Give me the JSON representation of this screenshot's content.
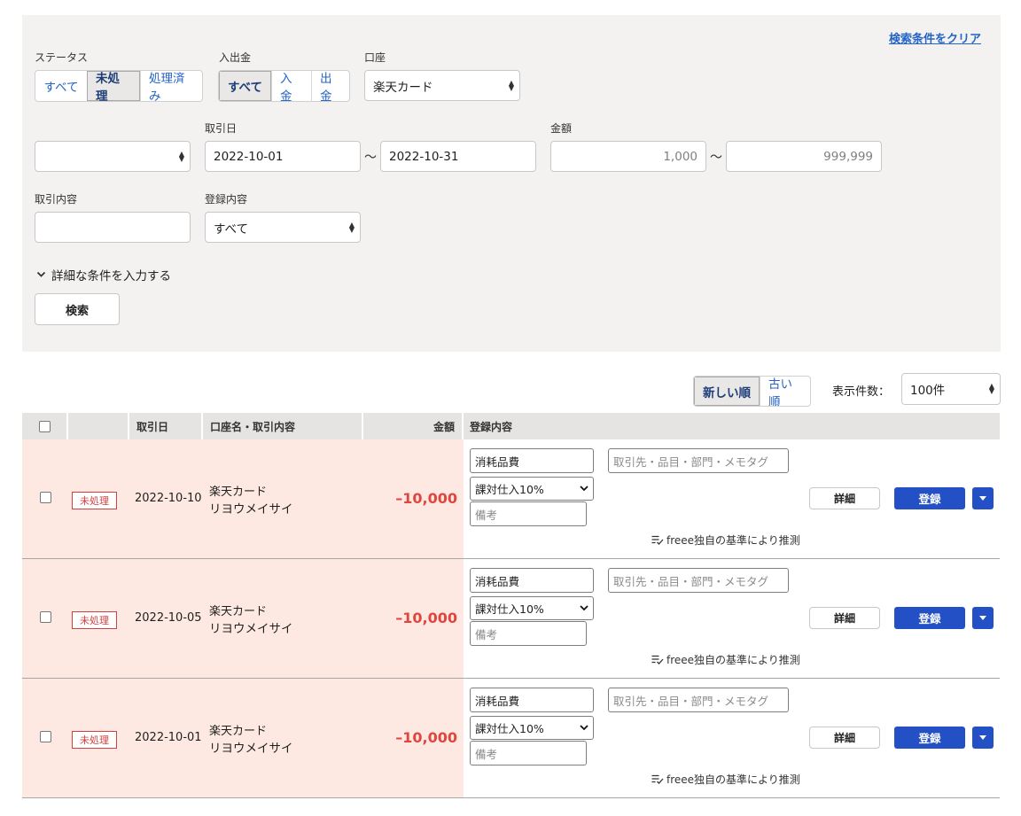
{
  "filters": {
    "clear_label": "検索条件をクリア",
    "status": {
      "label": "ステータス",
      "options": [
        "すべて",
        "未処理",
        "処理済み"
      ],
      "selected": "未処理"
    },
    "inout": {
      "label": "入出金",
      "options": [
        "すべて",
        "入金",
        "出金"
      ],
      "selected": "すべて"
    },
    "account": {
      "label": "口座",
      "value": "楽天カード"
    },
    "date_type": {
      "value": ""
    },
    "date": {
      "label": "取引日",
      "from": "2022-10-01",
      "to": "2022-10-31",
      "sep": "〜"
    },
    "amount": {
      "label": "金額",
      "min": "1,000",
      "max": "999,999",
      "sep": "〜"
    },
    "content": {
      "label": "取引内容",
      "value": ""
    },
    "registration": {
      "label": "登録内容",
      "value": "すべて"
    },
    "advanced_toggle": "詳細な条件を入力する",
    "search_button": "検索"
  },
  "toolbar": {
    "sort_options": [
      "新しい順",
      "古い順"
    ],
    "sort_selected": "新しい順",
    "page_size_label": "表示件数：",
    "page_size_value": "100件"
  },
  "table": {
    "headers": {
      "date": "取引日",
      "account": "口座名・取引内容",
      "amount": "金額",
      "registration": "登録内容"
    },
    "rows": [
      {
        "status": "未処理",
        "date": "2022-10-10",
        "account": "楽天カード",
        "description": "リヨウメイサイ",
        "amount": "–10,000",
        "category": "消耗品費",
        "tax": "課対仕入10%",
        "tags_placeholder": "取引先・品目・部門・メモタグ",
        "memo_placeholder": "備考",
        "detail_label": "詳細",
        "register_label": "登録",
        "note": "freee独自の基準により推測"
      },
      {
        "status": "未処理",
        "date": "2022-10-05",
        "account": "楽天カード",
        "description": "リヨウメイサイ",
        "amount": "–10,000",
        "category": "消耗品費",
        "tax": "課対仕入10%",
        "tags_placeholder": "取引先・品目・部門・メモタグ",
        "memo_placeholder": "備考",
        "detail_label": "詳細",
        "register_label": "登録",
        "note": "freee独自の基準により推測"
      },
      {
        "status": "未処理",
        "date": "2022-10-01",
        "account": "楽天カード",
        "description": "リヨウメイサイ",
        "amount": "–10,000",
        "category": "消耗品費",
        "tax": "課対仕入10%",
        "tags_placeholder": "取引先・品目・部門・メモタグ",
        "memo_placeholder": "備考",
        "detail_label": "詳細",
        "register_label": "登録",
        "note": "freee独自の基準により推測"
      }
    ]
  }
}
